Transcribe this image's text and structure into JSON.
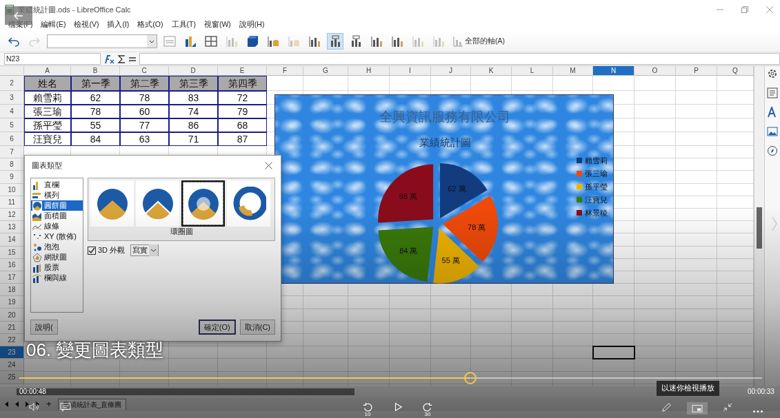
{
  "window": {
    "title": "業績統計圖.ods - LibreOffice Calc"
  },
  "menu": [
    "檔案(F)",
    "編輯(E)",
    "檢視(V)",
    "插入(I)",
    "格式(O)",
    "工具(T)",
    "視窗(W)",
    "說明(H)"
  ],
  "toolbar": {
    "buttons": [
      {
        "kind": "panel",
        "disabled": false,
        "selected": false
      },
      {
        "kind": "chart-type",
        "disabled": false,
        "selected": false
      },
      {
        "kind": "grid",
        "disabled": false,
        "selected": false
      },
      {
        "kind": "bars",
        "disabled": true,
        "selected": false
      },
      {
        "kind": "cube",
        "disabled": false,
        "selected": false
      },
      {
        "kind": "database",
        "disabled": false,
        "selected": false
      },
      {
        "kind": "database",
        "disabled": true,
        "selected": false
      },
      {
        "kind": "bars",
        "disabled": false,
        "selected": false
      },
      {
        "kind": "titled-bars",
        "disabled": false,
        "selected": true
      },
      {
        "kind": "titled-bars",
        "disabled": false,
        "selected": false
      },
      {
        "kind": "bars",
        "disabled": false,
        "selected": false
      },
      {
        "kind": "bars",
        "disabled": false,
        "selected": false
      },
      {
        "kind": "bars",
        "disabled": true,
        "selected": false
      },
      {
        "kind": "bars",
        "disabled": true,
        "selected": false
      }
    ],
    "axes_label": "全部的軸(A)"
  },
  "formula_bar": {
    "name_box": "N23"
  },
  "sheet": {
    "columns": [
      {
        "label": "A",
        "selected": false
      },
      {
        "label": "B",
        "selected": false
      },
      {
        "label": "C",
        "selected": false
      },
      {
        "label": "D",
        "selected": false
      },
      {
        "label": "E",
        "selected": false
      },
      {
        "label": "F",
        "selected": false
      },
      {
        "label": "G",
        "selected": false
      },
      {
        "label": "H",
        "selected": false
      },
      {
        "label": "I",
        "selected": false
      },
      {
        "label": "J",
        "selected": false
      },
      {
        "label": "K",
        "selected": false
      },
      {
        "label": "L",
        "selected": false
      },
      {
        "label": "M",
        "selected": false
      },
      {
        "label": "N",
        "selected": true
      },
      {
        "label": "O",
        "selected": false
      },
      {
        "label": "P",
        "selected": false
      },
      {
        "label": "Q",
        "selected": false
      }
    ],
    "rows": [
      {
        "label": "2",
        "selected": false,
        "kind": "header",
        "cells": [
          "姓名",
          "第一季",
          "第二季",
          "第三季",
          "第四季"
        ]
      },
      {
        "label": "3",
        "selected": false,
        "kind": "data",
        "cells": [
          "賴雪莉",
          "62",
          "78",
          "83",
          "72"
        ]
      },
      {
        "label": "4",
        "selected": false,
        "kind": "data",
        "cells": [
          "張三瑜",
          "78",
          "60",
          "74",
          "79"
        ]
      },
      {
        "label": "5",
        "selected": false,
        "kind": "data",
        "cells": [
          "孫平瑩",
          "55",
          "77",
          "86",
          "68"
        ]
      },
      {
        "label": "6",
        "selected": false,
        "kind": "data",
        "cells": [
          "汪寶兒",
          "84",
          "63",
          "71",
          "87"
        ]
      },
      {
        "label": "7",
        "selected": false
      },
      {
        "label": "8",
        "selected": false
      },
      {
        "label": "9",
        "selected": false
      },
      {
        "label": "10",
        "selected": false
      },
      {
        "label": "11",
        "selected": false
      },
      {
        "label": "12",
        "selected": false
      },
      {
        "label": "13",
        "selected": false
      },
      {
        "label": "14",
        "selected": false
      },
      {
        "label": "15",
        "selected": false
      },
      {
        "label": "16",
        "selected": false
      },
      {
        "label": "17",
        "selected": false
      },
      {
        "label": "18",
        "selected": false
      },
      {
        "label": "19",
        "selected": false
      },
      {
        "label": "20",
        "selected": false
      },
      {
        "label": "21",
        "selected": false
      },
      {
        "label": "22",
        "selected": false
      },
      {
        "label": "23",
        "selected": true
      },
      {
        "label": "24",
        "selected": false
      },
      {
        "label": "25",
        "selected": false
      }
    ]
  },
  "chart": {
    "subtitle": "業績統計圖",
    "slices": [
      {
        "color": "#123c7e"
      },
      {
        "color": "#f04a0a"
      },
      {
        "color": "#f0b400"
      },
      {
        "color": "#3a7a0a"
      },
      {
        "color": "#8a0c1c"
      }
    ],
    "chart_data": {
      "type": "pie",
      "title": "全興資訊服務有限公司",
      "categories": [
        "賴雪莉",
        "張三瑜",
        "孫平瑩",
        "汪寶兒",
        "林景稜"
      ],
      "values": [
        62,
        78,
        55,
        84,
        98
      ],
      "value_labels": [
        "62 萬",
        "78 萬",
        "55 萬",
        "84 萬",
        "98 萬"
      ],
      "legend": "right"
    }
  },
  "dialog": {
    "title": "圖表類型",
    "chart_types": [
      {
        "kind": "column",
        "label": "直欄",
        "selected": false
      },
      {
        "kind": "bar",
        "label": "橫列",
        "selected": false
      },
      {
        "kind": "pie",
        "label": "圓餅圖",
        "selected": true
      },
      {
        "kind": "area",
        "label": "面積圖",
        "selected": false
      },
      {
        "kind": "line",
        "label": "線條",
        "selected": false
      },
      {
        "kind": "scatter",
        "label": "XY (散佈)",
        "selected": false
      },
      {
        "kind": "bubble",
        "label": "泡泡",
        "selected": false
      },
      {
        "kind": "net",
        "label": "網狀圖",
        "selected": false
      },
      {
        "kind": "stock",
        "label": "股票",
        "selected": false
      },
      {
        "kind": "column-line",
        "label": "欄與線",
        "selected": false
      }
    ],
    "variants": [
      {
        "kind": "pie",
        "selected": false
      },
      {
        "kind": "exploded-pie",
        "selected": false
      },
      {
        "kind": "donut",
        "selected": true
      },
      {
        "kind": "exploded-donut",
        "selected": false
      }
    ],
    "variant_caption": "環圈圖",
    "three_d": {
      "label": "3D 外觀",
      "checked": true
    },
    "shape": "寫實",
    "buttons": [
      {
        "label": "說明(",
        "default": false
      },
      {
        "label": "確定(O)",
        "default": true
      },
      {
        "label": "取消(C)",
        "default": false
      }
    ]
  },
  "sheet_tabs": {
    "add": "+",
    "tabs": [
      {
        "label": "業績統計表_直條圖",
        "selected": true
      }
    ]
  },
  "video": {
    "caption": "06. 變更圖表類型",
    "level": 0.607,
    "elapsed": "00:00:48",
    "remaining": "00:00:33",
    "tooltip": "以迷你檢視播放",
    "skip_back": "10",
    "skip_forward": "30"
  }
}
